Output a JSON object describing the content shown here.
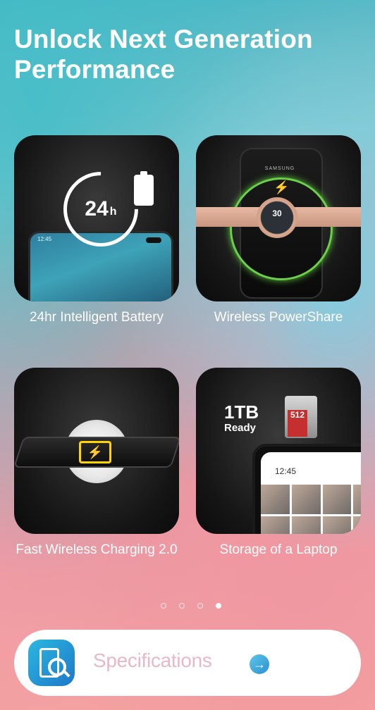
{
  "header": {
    "title": "Unlock Next Generation Performance"
  },
  "features": [
    {
      "caption": "24hr Intelligent Battery",
      "badge_text": "24",
      "badge_unit": "h",
      "phone_time": "12:45"
    },
    {
      "caption": "Wireless PowerShare",
      "brand": "SAMSUNG",
      "watch_value": "30"
    },
    {
      "caption": "Fast Wireless Charging 2.0"
    },
    {
      "caption": "Storage of a Laptop",
      "capacity": "1TB",
      "capacity_sub": "Ready",
      "phone_time": "12:45"
    }
  ],
  "pager": {
    "total": 4,
    "active_index": 3
  },
  "specifications": {
    "label": "Specifications"
  }
}
